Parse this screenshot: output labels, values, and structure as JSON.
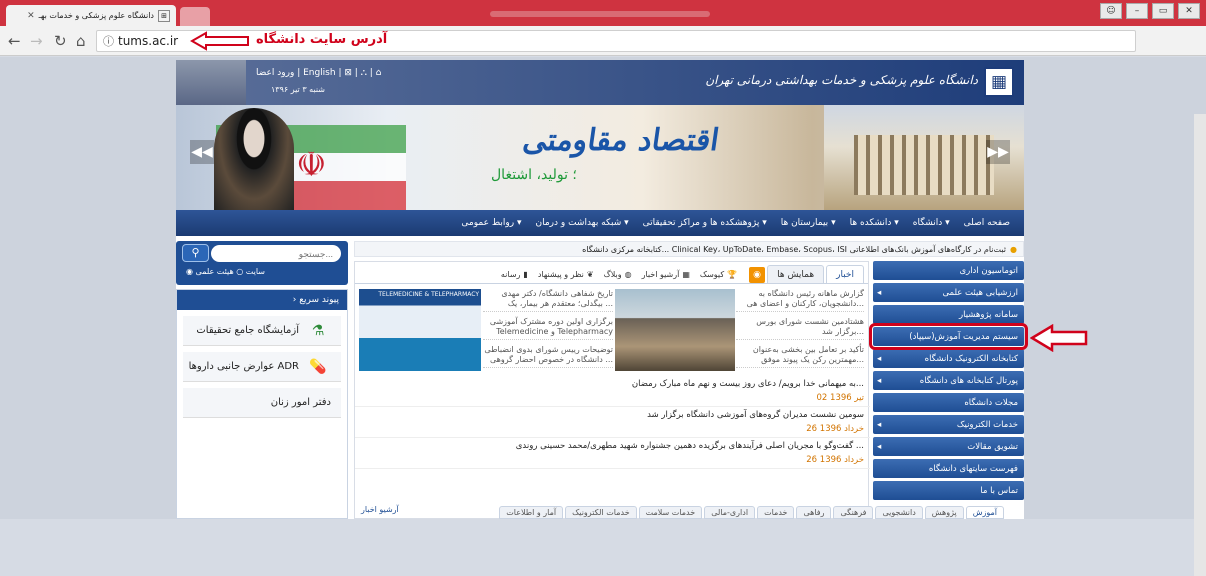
{
  "browser": {
    "tab_title": "دانشگاه علوم پزشکی و خدمات بهـ",
    "url": "tums.ac.ir",
    "annotation_url": "آدرس سایت دانشگاه"
  },
  "header": {
    "university_name": "دانشگاه علوم پزشکی و خدمات بهداشتی درمانی تهران",
    "top_links": "ورود اعضا | English | ⊠ | ⛬ | ⌂",
    "date": "شنبه ۳ تیر ۱۳۹۶"
  },
  "banner": {
    "slogan_main": "اقتصاد مقاومتی",
    "slogan_sub": "؛ تولید، اشتغال"
  },
  "menu": [
    "صفحه اصلی",
    "دانشگاه ▾",
    "دانشکده ها ▾",
    "بیمارستان ها ▾",
    "پژوهشکده ها و مراکز تحقیقاتی ▾",
    "شبکه بهداشت و درمان ▾",
    "روابط عمومی ▾"
  ],
  "search": {
    "placeholder": "جستجو...",
    "radio1": "سایت",
    "radio2": "هیئت علمی"
  },
  "quick_links": {
    "title": "› پیوند سریع",
    "items": [
      "آزمایشگاه جامع تحقیقات",
      "عوارض جانبی داروها  ADR",
      "دفتر امور زنان"
    ]
  },
  "ticker": "کتابخانه مرکزی دانشگاه... Clinical Key، UpToDate، Embase، Scopus، ISI ثبت‌نام در کارگاه‌های آموزش بانک‌های اطلاعاتی",
  "center_tabs": {
    "news": "اخبار",
    "exhibitions": "همایش ها",
    "kiosk": "کیوسک",
    "archive": "آرشیو اخبار",
    "weblog": "وبلاگ",
    "feedback": "نظر و پیشنهاد",
    "media": "رسانه"
  },
  "news_top_right": [
    "گزارش ماهانه رئیس دانشگاه به دانشجویان، کارکنان و اعضای هی...",
    "هشتادمین نشست شورای بورس برگزار شد...",
    "تأکید بر تعامل بین بخشی به‌عنوان مهمترین رکن یک پیوند موفق..."
  ],
  "news_top_mid": [
    "تاریخ شفاهی دانشگاه/ دکتر مهدی بیگدلی؛ معتقدم هر بیمار، یک ...",
    "برگزاری اولین دوره مشترک آموزشی Telemedicine و Telepharmacy",
    "توضیحات رییس شورای بدوی انضباطی دانشگاه در خصوص احضار گروهی ..."
  ],
  "promo_text": "TELEMEDICINE & TELEPHARMACY",
  "news_list": [
    {
      "title": "به میهمانی خدا برویم/ دعای روز بیست و نهم ماه مبارک رمضان...",
      "date": "02 تیر 1396"
    },
    {
      "title": "سومین نشست مدیران گروه‌های آموزشی دانشگاه برگزار شد",
      "date": "26 خرداد 1396"
    },
    {
      "title": "گفت‌وگو با مجریان اصلی فرآیندهای برگزیده دهمین جشنواره شهید مطهری/محمد حسینی روندی ...",
      "date": "26 خرداد 1396"
    }
  ],
  "archive_link": "آرشیو اخبار",
  "right_menu": [
    "اتوماسیون اداری",
    "ارزشیابی هیئت علمی",
    "سامانه پژوهشیار",
    "سیستم مدیریت آموزش(سیپاد)",
    "کتابخانه الکترونیک دانشگاه",
    "پورتال کتابخانه های دانشگاه",
    "مجلات دانشگاه",
    "خدمات الکترونیک",
    "تشویق مقالات",
    "فهرست سایتهای دانشگاه",
    "تماس با ما"
  ],
  "bottom_tabs": [
    "آموزش",
    "پژوهش",
    "دانشجویی",
    "فرهنگی",
    "رفاهی",
    "خدمات",
    "اداری-مالی",
    "خدمات سلامت",
    "خدمات الکترونیک",
    "آمار و اطلاعات"
  ],
  "colors": {
    "brand": "#1f4e94",
    "accent_red": "#d0021b",
    "date_orange": "#d27400"
  }
}
